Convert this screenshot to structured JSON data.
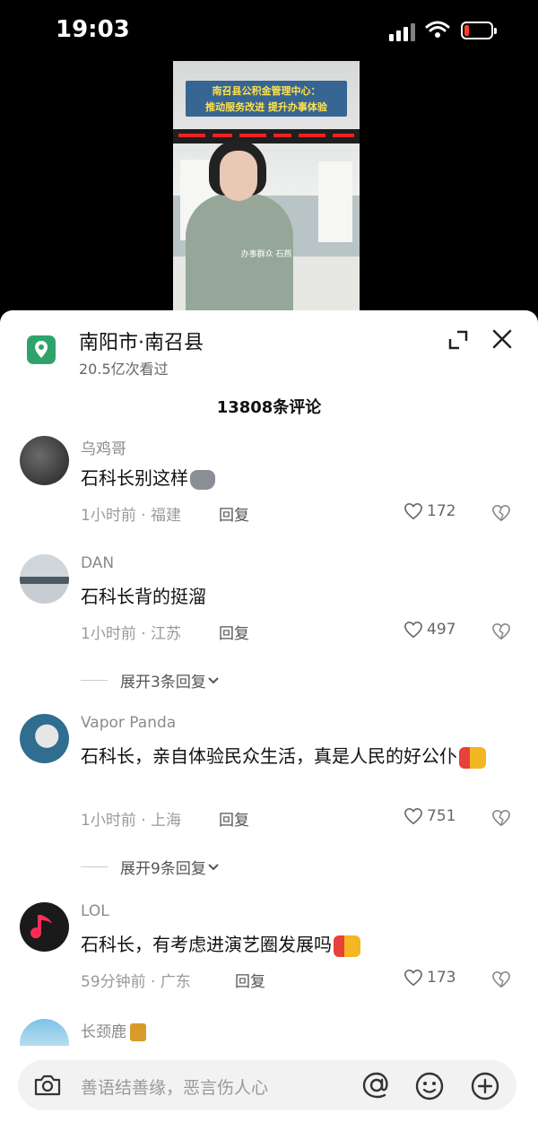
{
  "status_bar": {
    "time": "19:03"
  },
  "video": {
    "headline_line1": "南召县公积金管理中心：",
    "headline_line2": "推动服务改进 提升办事体验",
    "subtitle": "办事群众  石燕"
  },
  "location": {
    "title": "南阳市·南召县",
    "views": "20.5亿次看过"
  },
  "comments_header": "13808条评论",
  "comments": [
    {
      "user": "乌鸡哥",
      "text": "石科长别这样",
      "time_place": "1小时前 · 福建",
      "reply": "回复",
      "likes": "172"
    },
    {
      "user": "DAN",
      "text": "石科长背的挺溜",
      "time_place": "1小时前 · 江苏",
      "reply": "回复",
      "likes": "497",
      "expand": "展开3条回复"
    },
    {
      "user": "Vapor Panda",
      "text": "石科长，亲自体验民众生活，真是人民的好公仆",
      "time_place": "1小时前 · 上海",
      "reply": "回复",
      "likes": "751",
      "expand": "展开9条回复"
    },
    {
      "user": "LOL",
      "text": "石科长，有考虑进演艺圈发展吗",
      "time_place": "59分钟前 · 广东",
      "reply": "回复",
      "likes": "173"
    },
    {
      "user": "长颈鹿"
    }
  ],
  "input": {
    "placeholder": "善语结善缘，恶言伤人心"
  },
  "colors": {
    "accent_green": "#2fa36b",
    "emoji_thumb": "#f5b623",
    "emoji_red": "#e8403a"
  },
  "icons": [
    "location-icon",
    "expand-icon",
    "close-icon",
    "heart-icon",
    "dislike-icon",
    "chevron-down-icon",
    "camera-icon",
    "at-icon",
    "emoji-icon",
    "plus-icon"
  ]
}
